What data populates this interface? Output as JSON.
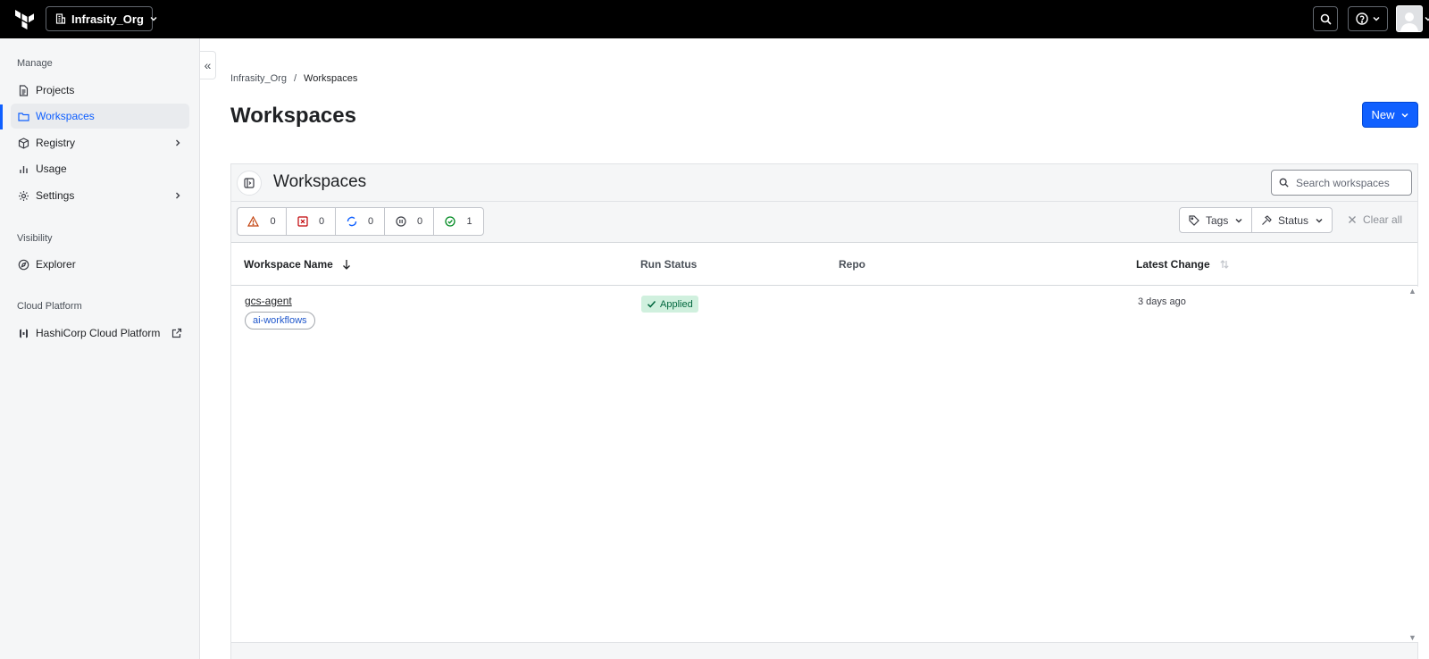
{
  "topbar": {
    "org_name": "Infrasity_Org",
    "icons": {
      "logo": "terraform-logo-icon",
      "org": "building-icon",
      "search": "search-icon",
      "help": "help-icon",
      "user": "user-avatar-icon"
    }
  },
  "sidebar": {
    "section_manage": "Manage",
    "section_visibility": "Visibility",
    "section_cloud": "Cloud Platform",
    "items": [
      {
        "label": "Projects",
        "icon": "file-text-icon"
      },
      {
        "label": "Workspaces",
        "icon": "folder-icon",
        "active": true
      },
      {
        "label": "Registry",
        "icon": "box-icon"
      },
      {
        "label": "Usage",
        "icon": "bar-chart-icon"
      },
      {
        "label": "Settings",
        "icon": "gear-icon"
      },
      {
        "label": "Explorer",
        "icon": "compass-icon"
      },
      {
        "label": "HashiCorp Cloud Platform",
        "icon": "hcp-icon"
      }
    ],
    "collapse_glyph": "«"
  },
  "breadcrumb": {
    "org": "Infrasity_Org",
    "sep": "/",
    "current": "Workspaces"
  },
  "page": {
    "title": "Workspaces",
    "new_label": "New"
  },
  "panel": {
    "title": "Workspaces",
    "search_placeholder": "Search workspaces",
    "status_counts": [
      {
        "icon": "warning-icon",
        "count": "0",
        "color": "#c2410c"
      },
      {
        "icon": "error-icon",
        "count": "0",
        "color": "#c00005"
      },
      {
        "icon": "running-icon",
        "count": "0",
        "color": "#1060ff"
      },
      {
        "icon": "paused-icon",
        "count": "0",
        "color": "#3b3d45"
      },
      {
        "icon": "success-icon",
        "count": "1",
        "color": "#008a22"
      }
    ],
    "tags_label": "Tags",
    "status_label": "Status",
    "clear_all_label": "Clear all"
  },
  "table": {
    "columns": {
      "name": "Workspace Name",
      "run_status": "Run Status",
      "repo": "Repo",
      "latest_change": "Latest Change"
    },
    "rows": [
      {
        "name": "gcs-agent",
        "tag": "ai-workflows",
        "run_status": "Applied",
        "repo": "",
        "latest_change": "3 days ago"
      }
    ]
  }
}
